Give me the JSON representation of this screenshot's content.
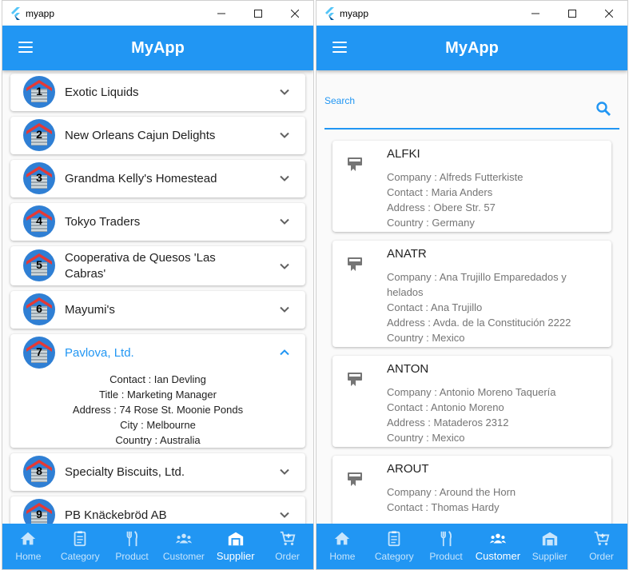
{
  "windows": [
    {
      "title": "myapp",
      "appbar_title": "MyApp",
      "suppliers": [
        {
          "num": "1",
          "name": "Exotic Liquids"
        },
        {
          "num": "2",
          "name": "New Orleans Cajun Delights"
        },
        {
          "num": "3",
          "name": "Grandma Kelly's Homestead"
        },
        {
          "num": "4",
          "name": "Tokyo Traders"
        },
        {
          "num": "5",
          "name_line1": "Cooperativa de Quesos 'Las",
          "name_line2": "Cabras'"
        },
        {
          "num": "6",
          "name": "Mayumi's"
        },
        {
          "num": "7",
          "name": "Pavlova, Ltd.",
          "details": [
            "Contact : Ian Devling",
            "Title : Marketing Manager",
            "Address : 74 Rose St. Moonie Ponds",
            "City : Melbourne",
            "Country : Australia"
          ]
        },
        {
          "num": "8",
          "name": "Specialty Biscuits, Ltd."
        },
        {
          "num": "9",
          "name": "PB Knäckebröd AB"
        }
      ]
    },
    {
      "title": "myapp",
      "appbar_title": "MyApp",
      "search_label": "Search",
      "customers": [
        {
          "id": "ALFKI",
          "lines": [
            "Company : Alfreds Futterkiste",
            "Contact : Maria Anders",
            "Address : Obere Str. 57",
            "Country : Germany"
          ]
        },
        {
          "id": "ANATR",
          "lines": [
            "Company : Ana Trujillo Emparedados y helados",
            "Contact : Ana Trujillo",
            "Address : Avda. de la Constitución 2222",
            "Country : Mexico"
          ]
        },
        {
          "id": "ANTON",
          "lines": [
            "Company : Antonio Moreno Taquería",
            "Contact : Antonio Moreno",
            "Address : Mataderos  2312",
            "Country : Mexico"
          ]
        },
        {
          "id": "AROUT",
          "lines": [
            "Company : Around the Horn",
            "Contact : Thomas Hardy"
          ]
        }
      ]
    }
  ],
  "nav": [
    "Home",
    "Category",
    "Product",
    "Customer",
    "Supplier",
    "Order"
  ],
  "nav_icons": [
    "home-icon",
    "category-icon",
    "product-icon",
    "customer-icon",
    "supplier-icon",
    "order-icon"
  ],
  "active_nav": {
    "left": "Supplier",
    "right": "Customer"
  },
  "colors": {
    "primary": "#2196f3",
    "text": "#212121",
    "secondary_text": "#757575"
  }
}
